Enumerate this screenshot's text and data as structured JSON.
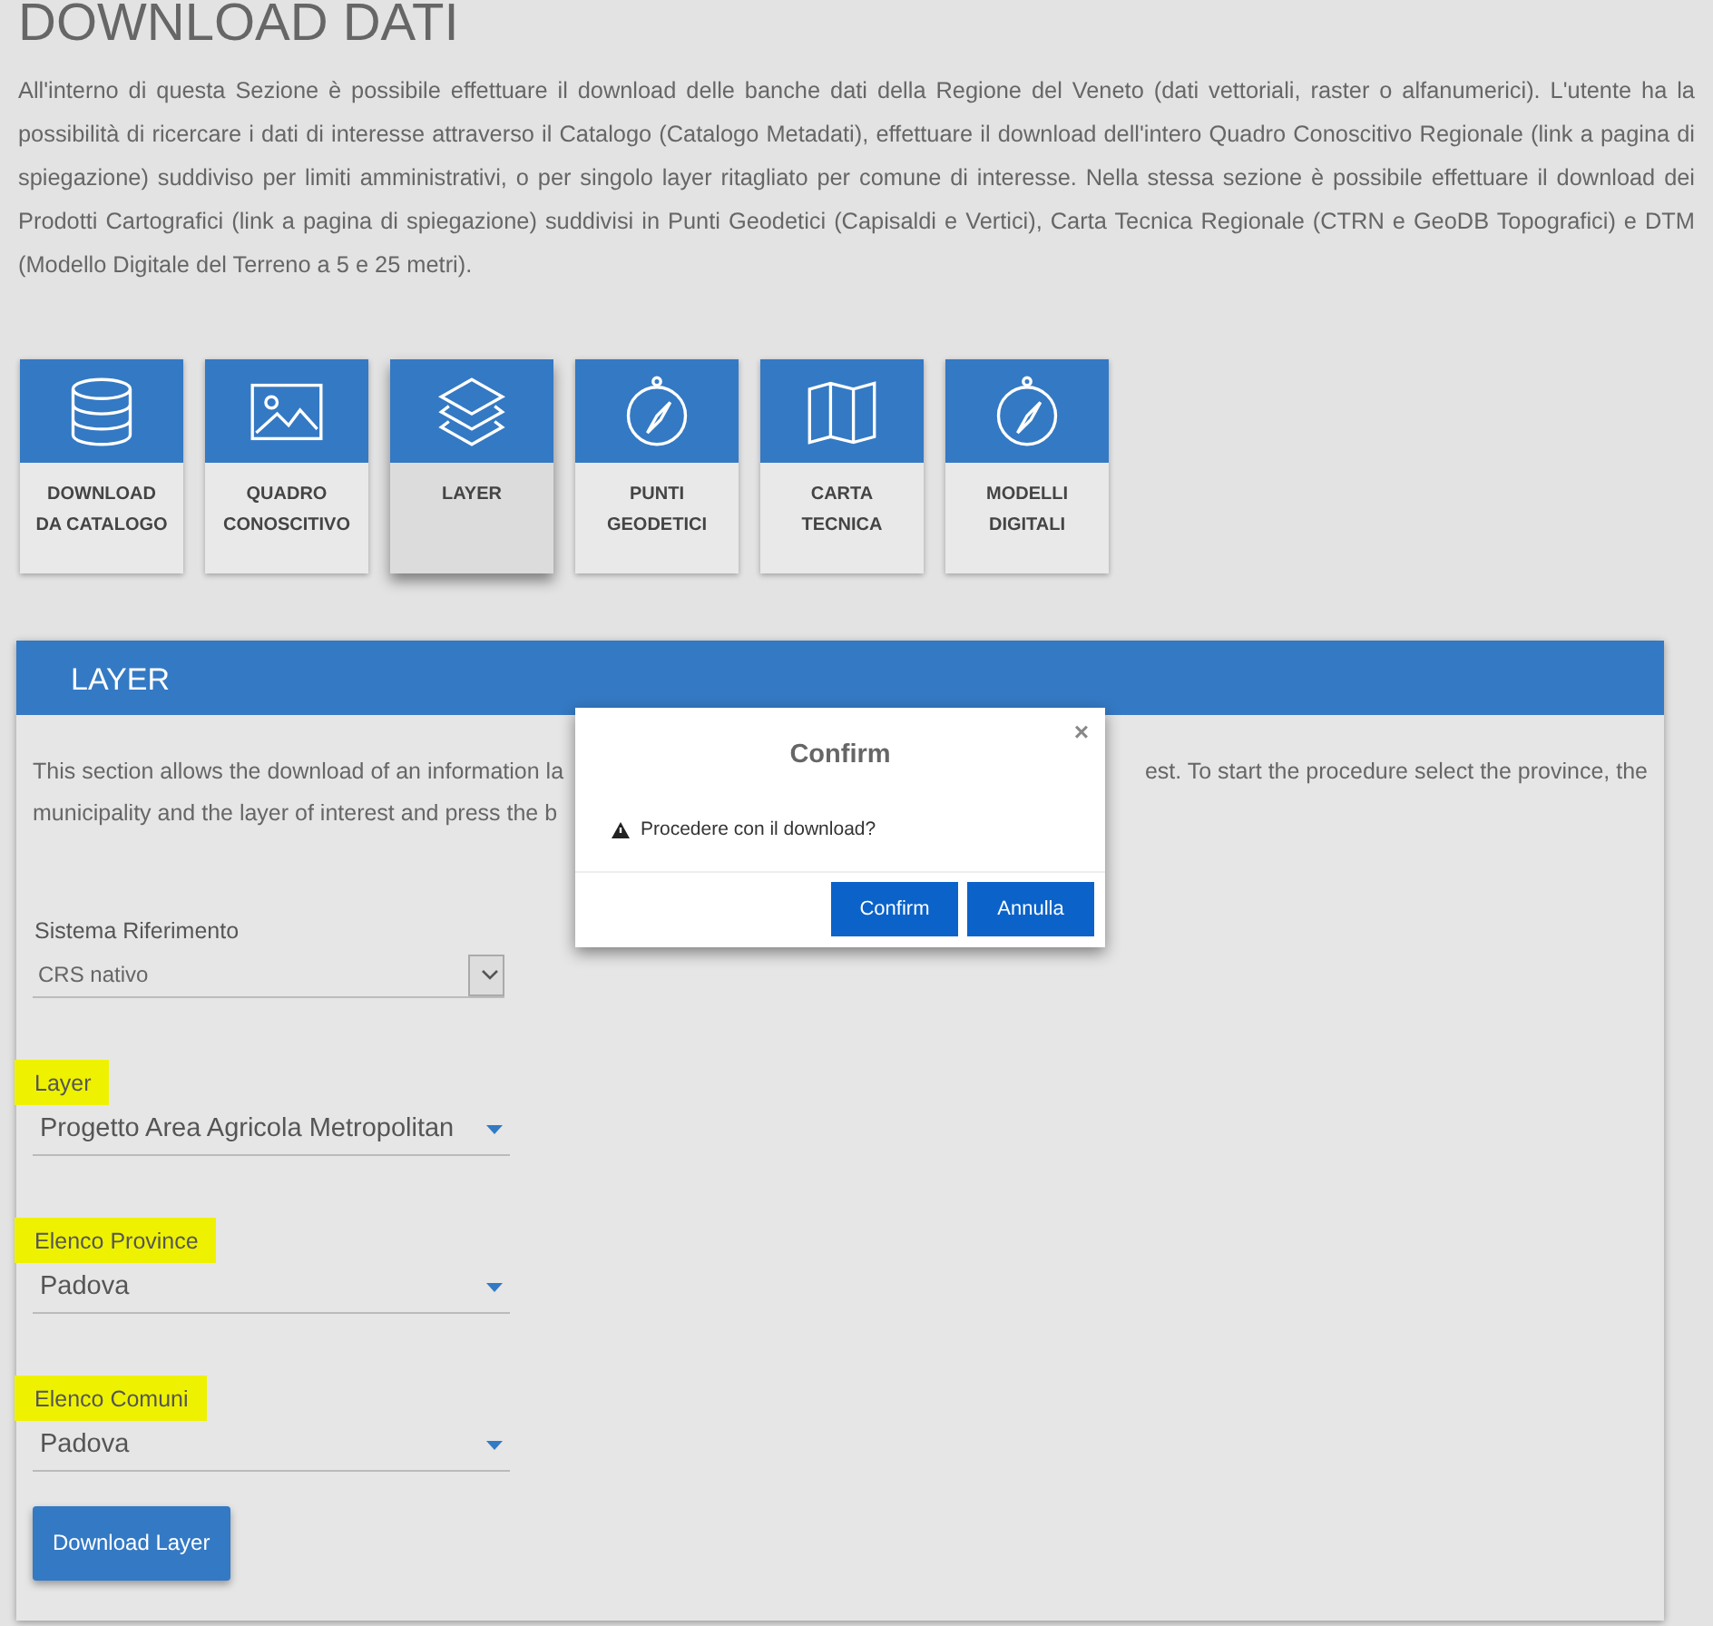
{
  "page_title": "DOWNLOAD DATI",
  "intro": "All'interno di questa Sezione è possibile effettuare il download delle banche dati della Regione del Veneto (dati vettoriali, raster o alfanumerici). L'utente ha la possibilità di ricercare i dati di interesse attraverso il Catalogo (Catalogo Metadati), effettuare il download dell'intero Quadro Conoscitivo Regionale (link a pagina di spiegazione) suddiviso per limiti amministrativi, o per singolo layer ritagliato per comune di interesse. Nella stessa sezione è possibile effettuare il download dei Prodotti Cartografici (link a pagina di spiegazione) suddivisi in Punti Geodetici (Capisaldi e Vertici), Carta Tecnica Regionale (CTRN e GeoDB Topografici) e DTM (Modello Digitale del Terreno a 5 e 25 metri).",
  "tiles": [
    {
      "lines": [
        "DOWNLOAD",
        "DA CATALOGO"
      ],
      "selected": false
    },
    {
      "lines": [
        "QUADRO",
        "CONOSCITIVO"
      ],
      "selected": false
    },
    {
      "lines": [
        "LAYER"
      ],
      "selected": true
    },
    {
      "lines": [
        "PUNTI",
        "GEODETICI"
      ],
      "selected": false
    },
    {
      "lines": [
        "CARTA",
        "TECNICA"
      ],
      "selected": false
    },
    {
      "lines": [
        "MODELLI",
        "DIGITALI"
      ],
      "selected": false
    }
  ],
  "panel": {
    "title": "LAYER",
    "description_visible": {
      "line_1_left": "This section allows the download of an information la",
      "line_1_right": "est. To start the procedure select the province, the",
      "line_2_left": "municipality and the layer of interest and press the b"
    },
    "fields": [
      {
        "kind": "native",
        "label": "Sistema Riferimento",
        "value": "CRS nativo",
        "highlighted": false
      },
      {
        "kind": "material",
        "label": "Layer",
        "value": "Progetto Area Agricola Metropolitan",
        "highlighted": true
      },
      {
        "kind": "material",
        "label": "Elenco Province",
        "value": "Padova",
        "highlighted": true
      },
      {
        "kind": "material",
        "label": "Elenco Comuni",
        "value": "Padova",
        "highlighted": true
      }
    ],
    "button": "Download Layer"
  },
  "dialog": {
    "title": "Confirm",
    "close": "×",
    "message": "Procedere con il download?",
    "buttons": [
      "Confirm",
      "Annulla"
    ]
  }
}
